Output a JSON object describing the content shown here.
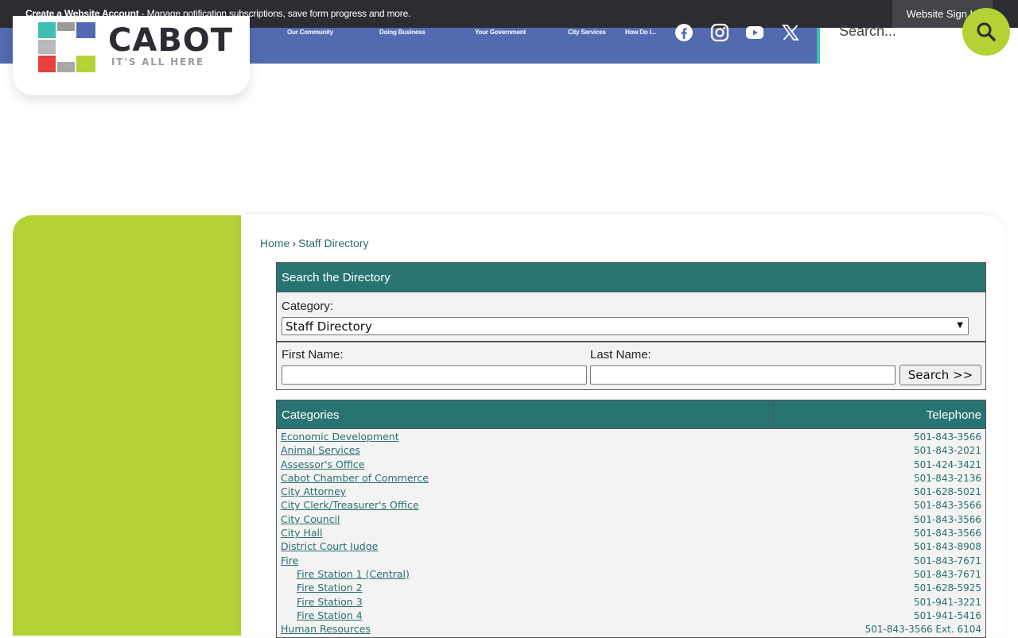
{
  "topbar": {
    "create_account": "Create a Website Account",
    "message": " - Manage notification subscriptions, save form progress and more.",
    "sign_in": "Website Sign In"
  },
  "logo": {
    "word": "CABOT",
    "tagline": "IT'S ALL HERE"
  },
  "nav": {
    "items": [
      "Our Community",
      "Doing Business",
      "Your Government",
      "City Services",
      "How Do I..."
    ]
  },
  "social": [
    "facebook-icon",
    "instagram-icon",
    "youtube-icon",
    "x-twitter-icon"
  ],
  "search": {
    "placeholder": "Search..."
  },
  "breadcrumb": {
    "home": "Home",
    "separator": "›",
    "current": "Staff Directory"
  },
  "directory_search": {
    "title": "Search the Directory",
    "category_label": "Category:",
    "category_value": "Staff Directory",
    "first_name_label": "First Name:",
    "last_name_label": "Last Name:",
    "search_button": "Search >>"
  },
  "categories": {
    "header_left": "Categories",
    "header_right": "Telephone",
    "rows": [
      {
        "name": "Economic Development",
        "phone": "501-843-3566",
        "indent": 0
      },
      {
        "name": "Animal Services",
        "phone": "501-843-2021",
        "indent": 0
      },
      {
        "name": "Assessor's Office",
        "phone": "501-424-3421",
        "indent": 0
      },
      {
        "name": "Cabot Chamber of Commerce",
        "phone": "501-843-2136",
        "indent": 0
      },
      {
        "name": "City Attorney",
        "phone": "501-628-5021",
        "indent": 0
      },
      {
        "name": "City Clerk/Treasurer's Office",
        "phone": "501-843-3566",
        "indent": 0
      },
      {
        "name": "City Council",
        "phone": "501-843-3566",
        "indent": 0
      },
      {
        "name": "City Hall",
        "phone": "501-843-3566",
        "indent": 0
      },
      {
        "name": "District Court Judge",
        "phone": "501-843-8908",
        "indent": 0
      },
      {
        "name": "Fire",
        "phone": "501-843-7671",
        "indent": 0
      },
      {
        "name": "Fire Station 1 (Central)",
        "phone": "501-843-7671",
        "indent": 1
      },
      {
        "name": "Fire Station 2",
        "phone": "501-628-5925",
        "indent": 1
      },
      {
        "name": "Fire Station 3",
        "phone": "501-941-3221",
        "indent": 1
      },
      {
        "name": "Fire Station 4",
        "phone": "501-941-5416",
        "indent": 1
      },
      {
        "name": "Human Resources",
        "phone": "501-843-3566 Ext. 6104",
        "indent": 0
      }
    ]
  },
  "colors": {
    "topbar": "#2b2d33",
    "nav_band": "#526bb0",
    "accent_green": "#b2d235",
    "teal_header": "#287473",
    "link": "#2a6e6e"
  }
}
